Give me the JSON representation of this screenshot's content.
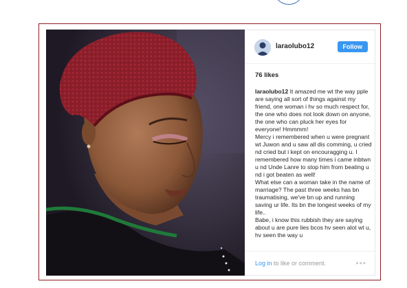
{
  "post": {
    "username": "laraolubo12",
    "follow_label": "Follow",
    "likes": "76 likes",
    "caption_user": "laraolubo12",
    "caption_lines": [
      "It amazed me wt the way pple are saying all sort of things against my friend, one woman i hv so much respect for, the one who does not look down on anyone, the one who can pluck her eyes for everyone! Hmmmm!",
      "Mercy i remembered when u were pregnant wt Juwon and u saw all dis comming, u cried nd cried but i kept on encouragging u. I remembered how many times i came inbtwn u nd Unde Lanre to stop him from beating u nd i got beaten as well!",
      "What else can a woman take in the name of marriage? The past three weeks has bn traumatising, we've bn up and running saving ur life. Its bn the longest weeks of my life..",
      "Babe, i know this rubbish they are saying about u are pure lies bcos hv seen alot wt u, hv seen the way u"
    ],
    "footer_login": "Log in",
    "footer_rest": " to like or comment.",
    "more_icon": "ellipsis-icon"
  },
  "colors": {
    "frame_border": "#8c1a1f",
    "follow_button": "#3897f0",
    "login_link": "#3897f0",
    "headwrap": "#8a1e2a"
  }
}
